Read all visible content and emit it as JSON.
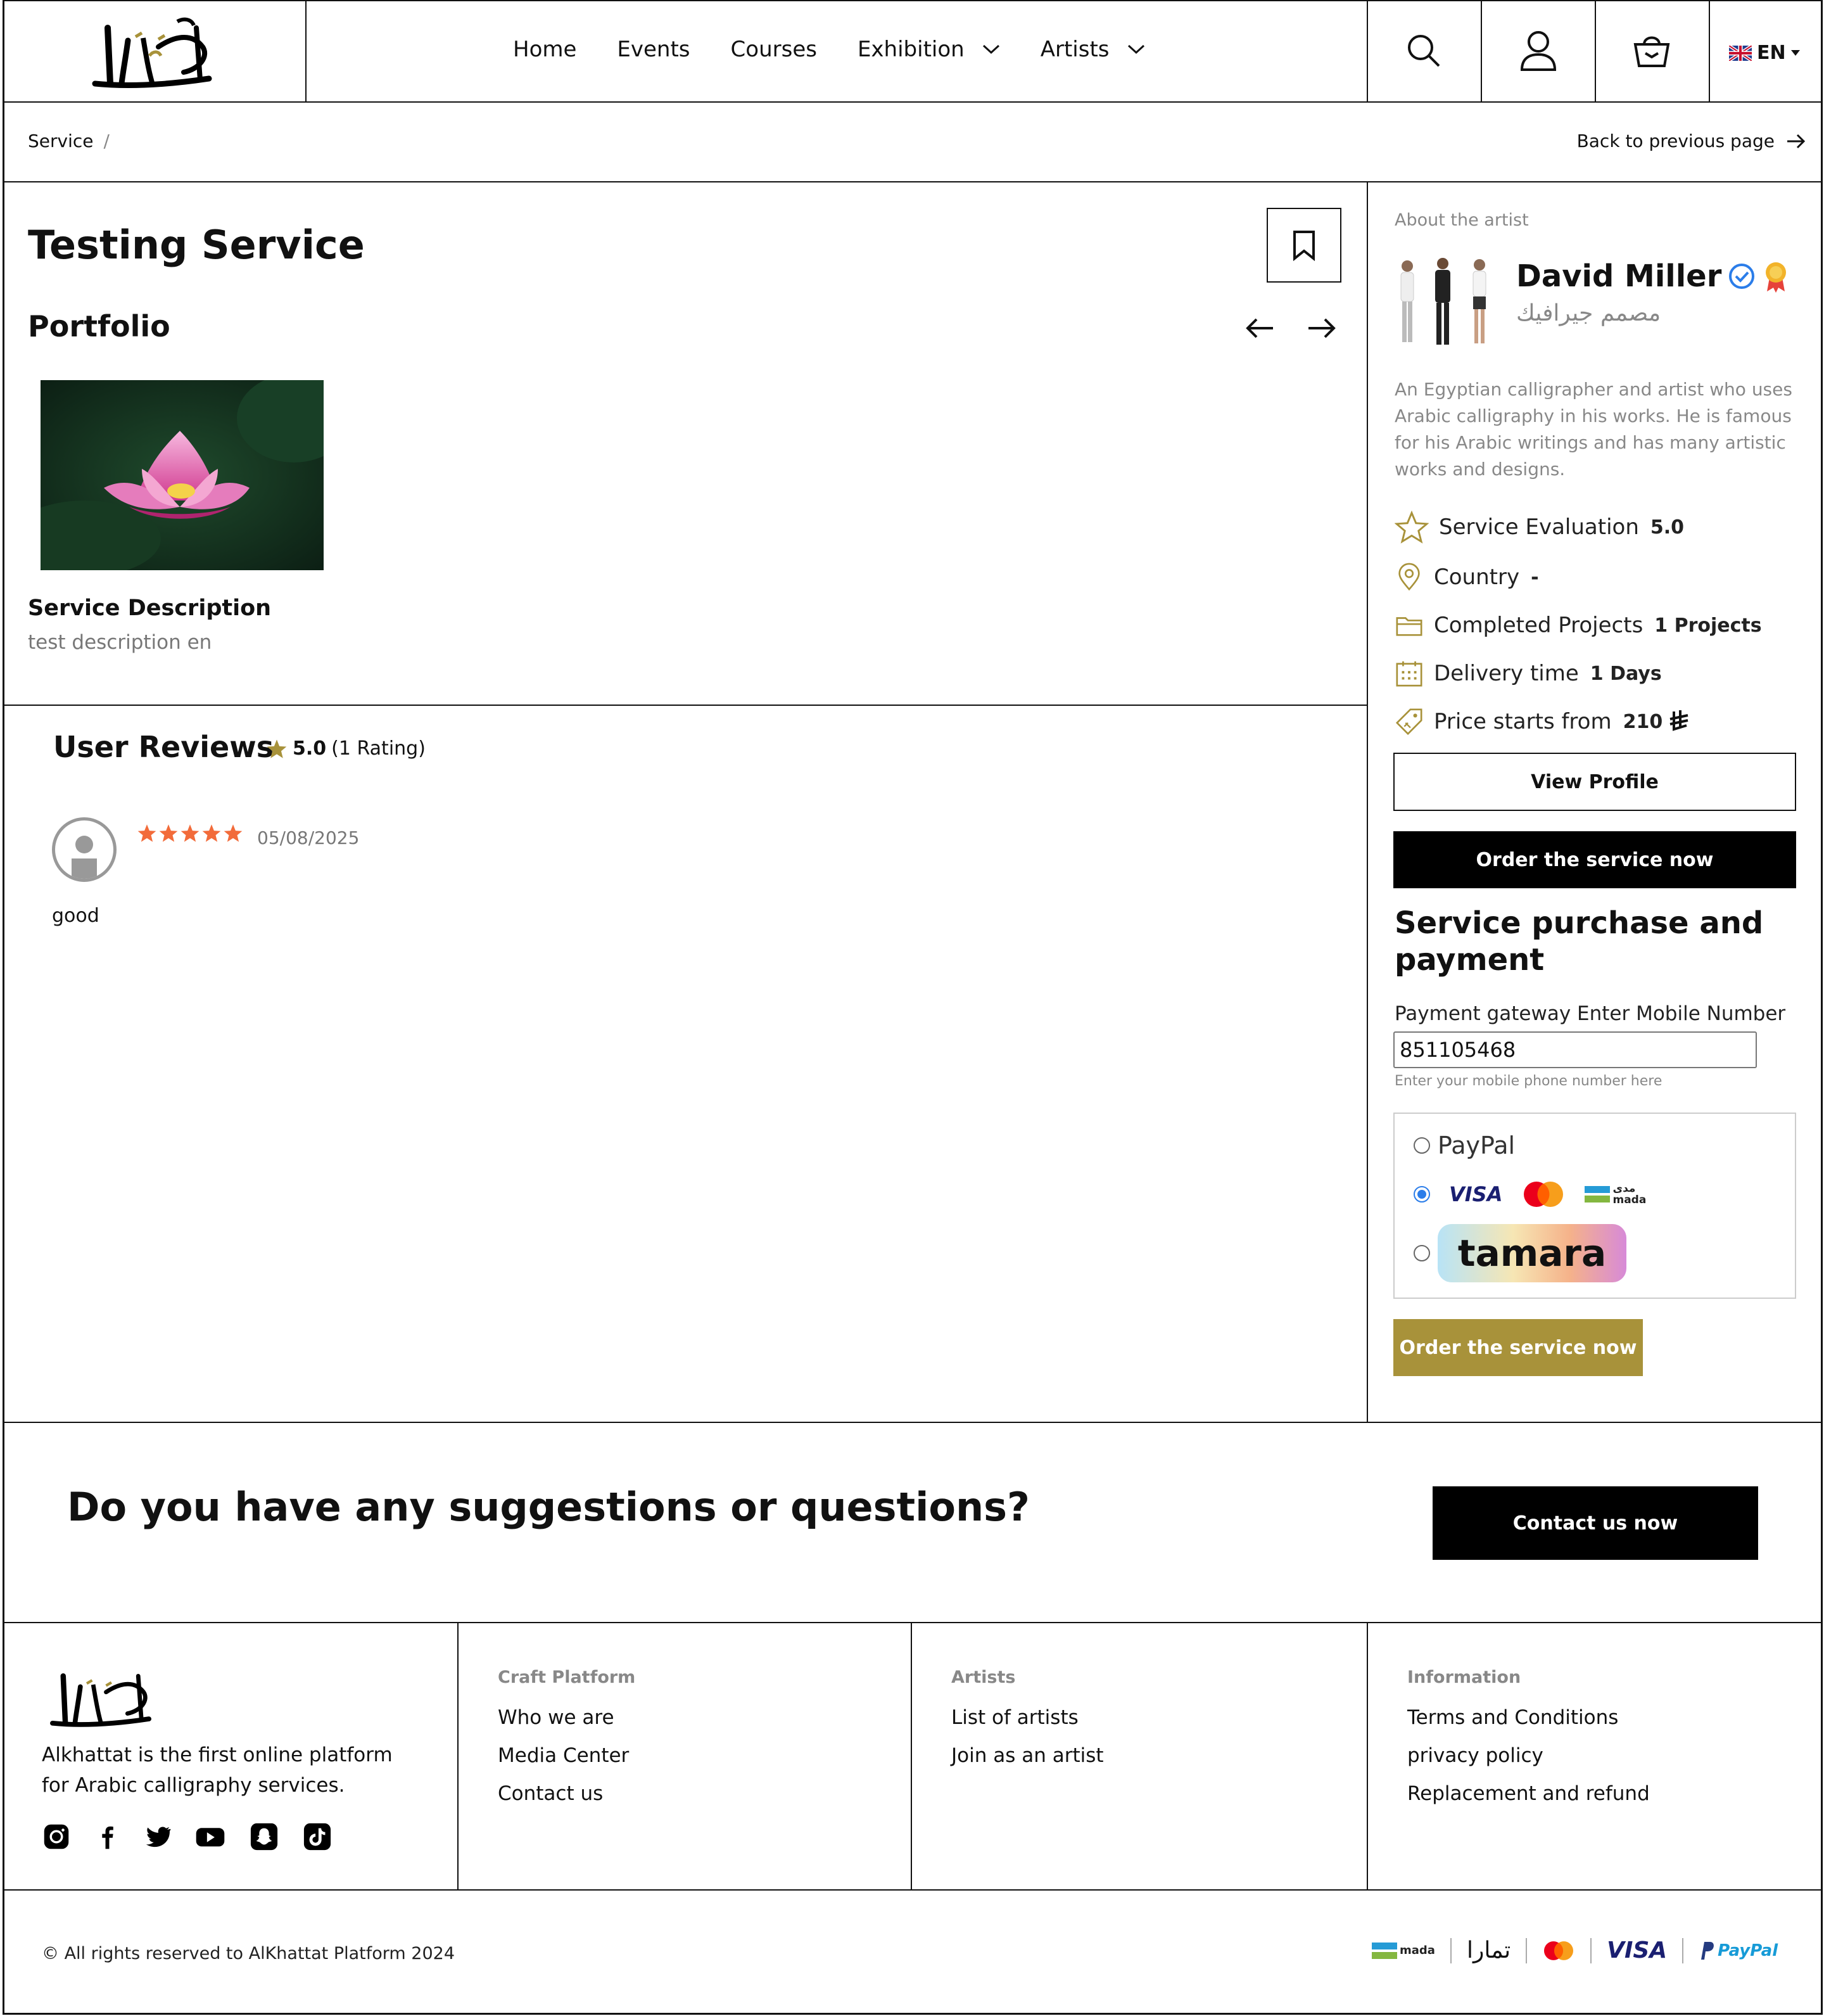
{
  "header": {
    "logo_text": "الخطاط",
    "nav": [
      "Home",
      "Events",
      "Courses",
      "Exhibition",
      "Artists"
    ],
    "language": "EN"
  },
  "breadcrumb": {
    "item": "Service",
    "separator": "/",
    "back_label": "Back to previous page"
  },
  "service": {
    "title": "Testing Service",
    "portfolio_heading": "Portfolio",
    "description_heading": "Service Description",
    "description": "test description en"
  },
  "reviews": {
    "heading": "User Reviews",
    "rating": "5.0",
    "rating_count": "(1 Rating)",
    "items": [
      {
        "date": "05/08/2025",
        "stars": 5,
        "text": "good"
      }
    ]
  },
  "artist": {
    "section_label": "About the artist",
    "name": "David Miller",
    "subtitle": "مصمم جيرافيك",
    "bio": "An Egyptian calligrapher and artist who uses Arabic calligraphy in his works. He is famous for his Arabic writings and has many artistic works and designs.",
    "stats": [
      {
        "label": "Service Evaluation",
        "value": "5.0",
        "icon": "star-outline-icon"
      },
      {
        "label": "Country",
        "value": "-",
        "icon": "location-pin-icon"
      },
      {
        "label": "Completed Projects",
        "value": "1 Projects",
        "icon": "folder-icon"
      },
      {
        "label": "Delivery time",
        "value": "1 Days",
        "icon": "calendar-icon"
      },
      {
        "label": "Price starts from",
        "value": "210",
        "icon": "price-tag-icon"
      }
    ],
    "view_profile_label": "View Profile",
    "order_label": "Order the service now"
  },
  "payment": {
    "heading": "Service purchase and payment",
    "field_label": "Payment gateway Enter Mobile Number",
    "phone_value": "851105468",
    "helper": "Enter your mobile phone number here",
    "options": [
      {
        "label": "PayPal",
        "checked": false
      },
      {
        "label": "VISA",
        "checked": true
      },
      {
        "label": "tamara",
        "checked": false
      }
    ],
    "mada_label": "mada",
    "mada_ar": "مدى",
    "order_label": "Order the service now"
  },
  "cta": {
    "question": "Do you have any suggestions or questions?",
    "button": "Contact us now"
  },
  "footer": {
    "tagline": "Alkhattat is the first online platform for Arabic calligraphy services.",
    "columns": [
      {
        "heading": "Craft Platform",
        "links": [
          "Who we are",
          "Media Center",
          "Contact us"
        ]
      },
      {
        "heading": "Artists",
        "links": [
          "List of artists",
          "Join as an artist"
        ]
      },
      {
        "heading": "Information",
        "links": [
          "Terms and Conditions",
          "privacy policy",
          "Replacement and refund"
        ]
      }
    ],
    "copyright": "© All rights reserved to AlKhattat Platform 2024",
    "payment_logos": [
      "mada",
      "تمارا",
      "VISA",
      "PayPal"
    ]
  },
  "colors": {
    "gold": "#A8923A",
    "black": "#000000",
    "star_orange": "#F26B3A"
  }
}
